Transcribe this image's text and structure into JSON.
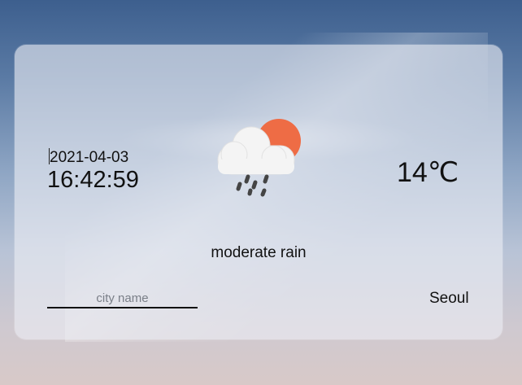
{
  "weather": {
    "date": "2021-04-03",
    "time": "16:42:59",
    "temperature": "14℃",
    "description": "moderate rain",
    "icon": "cloud-sun-rain-icon",
    "city": "Seoul"
  },
  "search": {
    "placeholder": "city name",
    "value": ""
  },
  "colors": {
    "sun": "#ee6c45",
    "cloud": "#f4f4f4",
    "rain": "#444444",
    "card": "#e8ebf1",
    "text": "#111111"
  }
}
